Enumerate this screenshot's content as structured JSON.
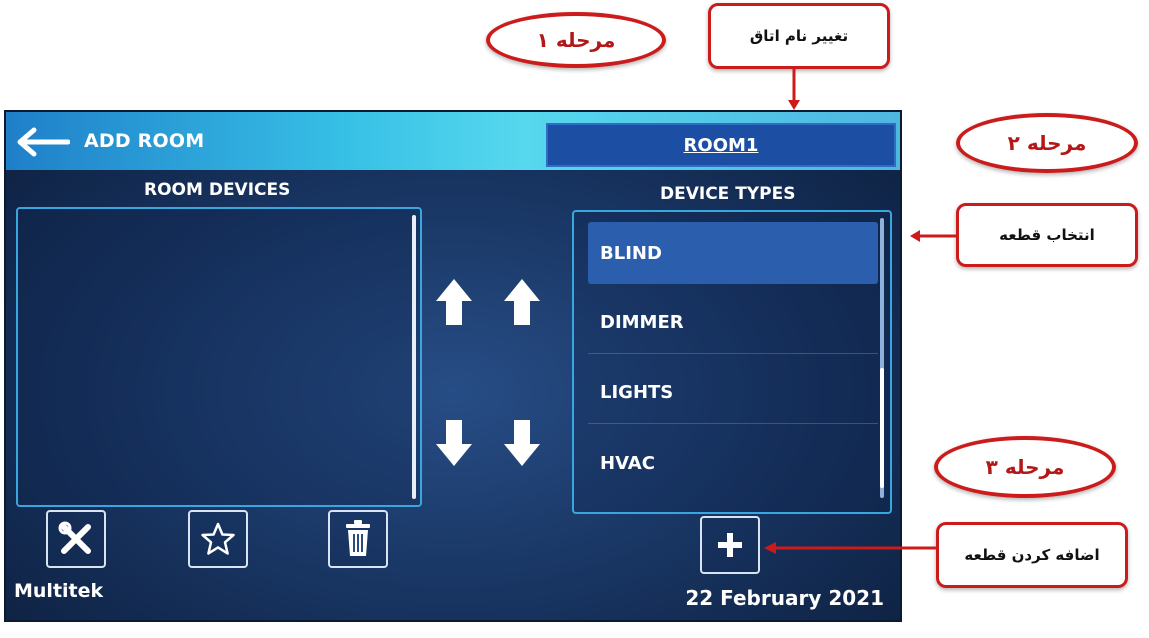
{
  "screen": {
    "title": "ADD ROOM",
    "room_name": "ROOM1",
    "room_devices_label": "ROOM DEVICES",
    "device_types_label": "DEVICE TYPES",
    "device_types": [
      "BLIND",
      "DIMMER",
      "LIGHTS",
      "HVAC"
    ],
    "selected_device_type": "BLIND",
    "brand": "Multitek",
    "date": "22 February 2021"
  },
  "annotations": {
    "step1": "مرحله ۱",
    "step2": "مرحله ۲",
    "step3": "مرحله ۳",
    "rename_room": "تغییر نام اتاق",
    "select_device": "انتخاب قطعه",
    "add_device": "اضافه کردن قطعه"
  },
  "colors": {
    "accent_annotation": "#cc1b1b",
    "screen_bg": "#17335f",
    "selected_item": "#2b5fae",
    "list_border": "#3aa6e0"
  },
  "icons": {
    "back": "arrow-left-icon",
    "move_up": "arrow-up-icon",
    "move_down": "arrow-down-icon",
    "settings": "tools-icon",
    "favorite": "star-icon",
    "delete": "trash-icon",
    "add": "plus-icon"
  }
}
